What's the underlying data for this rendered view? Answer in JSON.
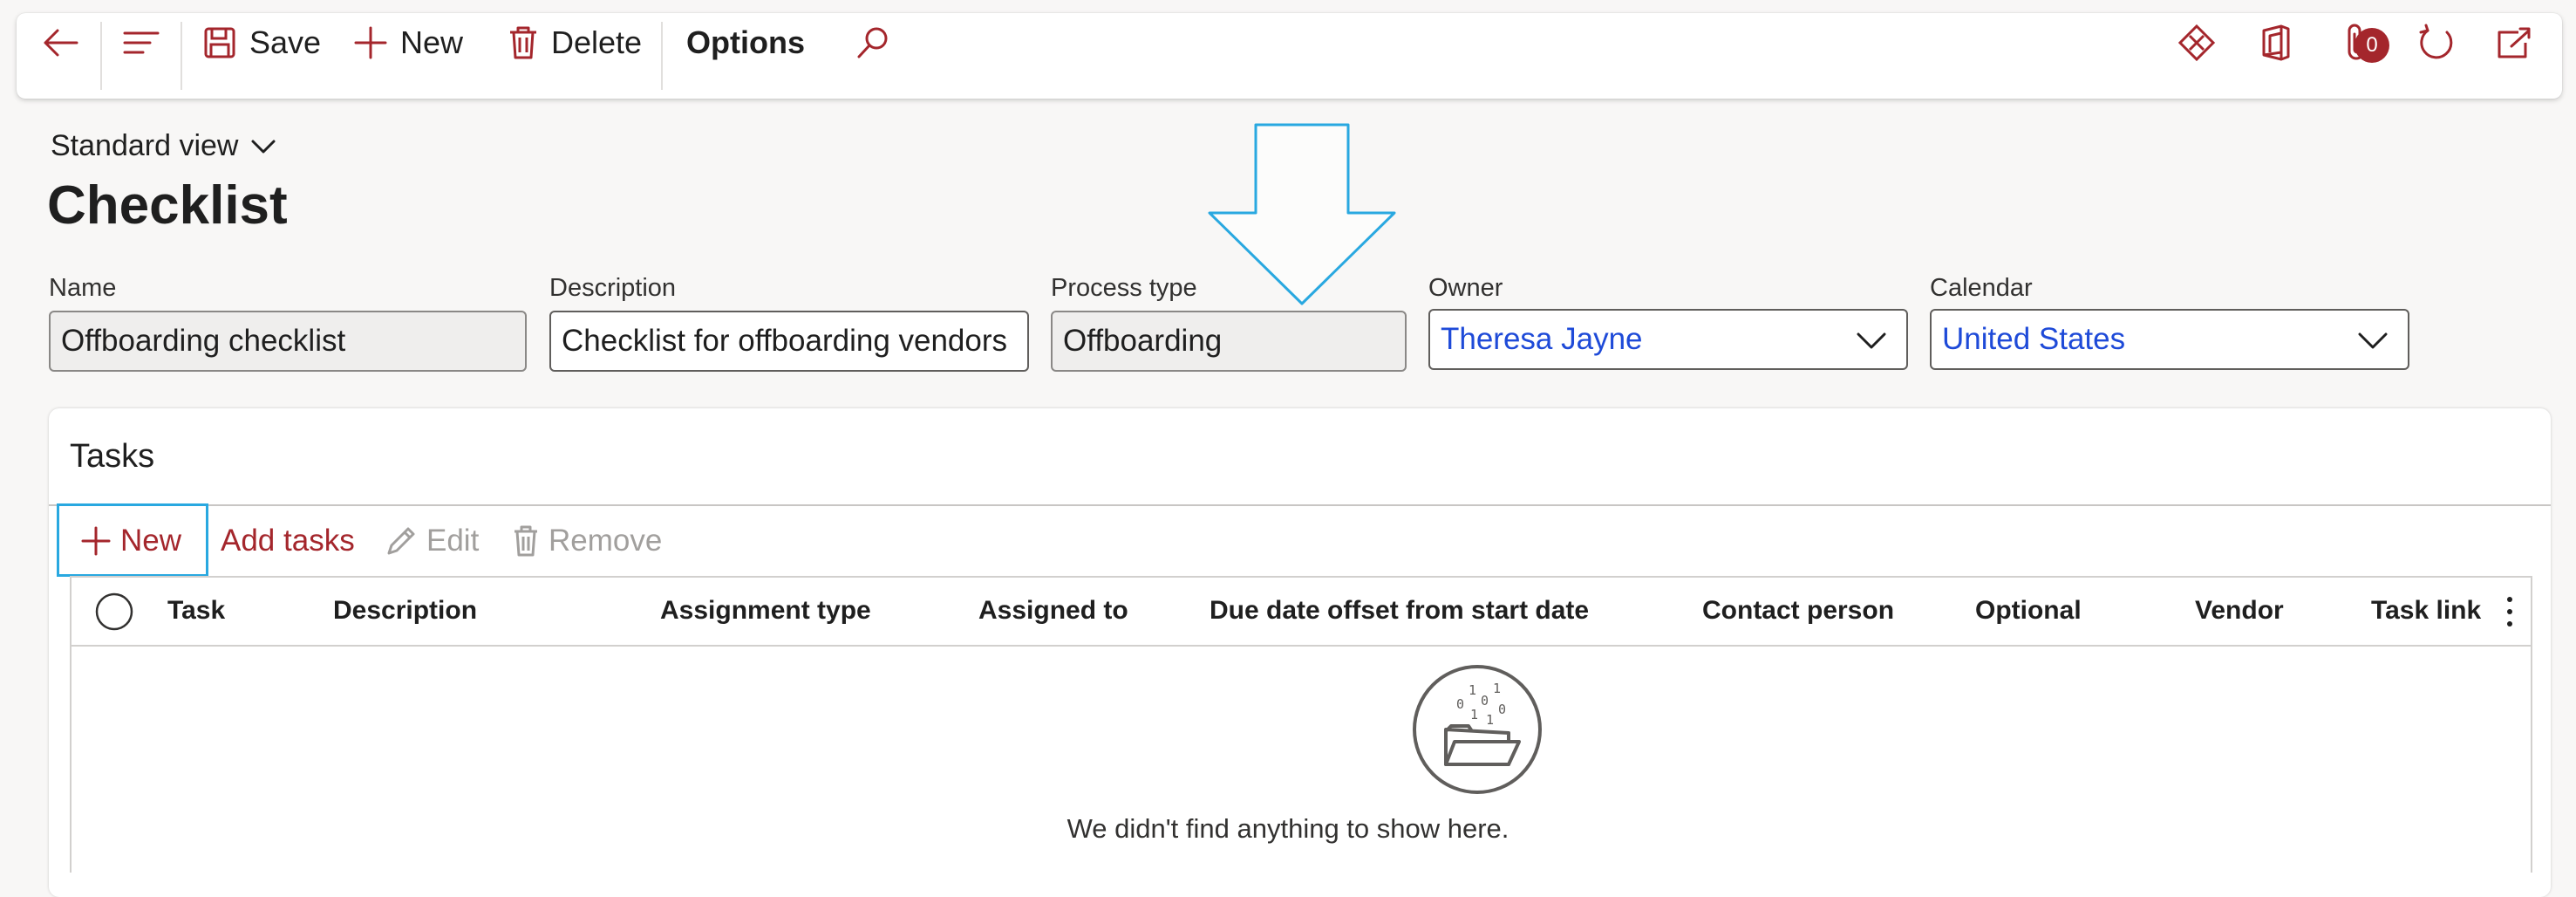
{
  "toolbar": {
    "save_label": "Save",
    "new_label": "New",
    "delete_label": "Delete",
    "options_label": "Options",
    "notification_count": "0"
  },
  "header": {
    "view_selector": "Standard view",
    "title": "Checklist"
  },
  "fields": {
    "name": {
      "label": "Name",
      "value": "Offboarding checklist"
    },
    "description": {
      "label": "Description",
      "value": "Checklist for offboarding vendors"
    },
    "process_type": {
      "label": "Process type",
      "value": "Offboarding"
    },
    "owner": {
      "label": "Owner",
      "value": "Theresa Jayne"
    },
    "calendar": {
      "label": "Calendar",
      "value": "United States"
    }
  },
  "tasks": {
    "title": "Tasks",
    "actions": {
      "new": "New",
      "add_tasks": "Add tasks",
      "edit": "Edit",
      "remove": "Remove"
    },
    "columns": [
      "Task",
      "Description",
      "Assignment type",
      "Assigned to",
      "Due date offset from start date",
      "Contact person",
      "Optional",
      "Vendor",
      "Task link"
    ],
    "empty_message": "We didn't find anything to show here."
  },
  "colors": {
    "accent": "#a4262c",
    "link": "#1e4ad8",
    "highlight": "#29a8e0"
  },
  "icons": [
    "back-arrow-icon",
    "hamburger-icon",
    "save-icon",
    "plus-icon",
    "trash-icon",
    "search-icon",
    "diamond-icon",
    "office-icon",
    "attachment-icon",
    "refresh-icon",
    "open-new-window-icon",
    "chevron-down-icon",
    "pencil-icon",
    "more-vertical-icon",
    "empty-folder-icon"
  ]
}
